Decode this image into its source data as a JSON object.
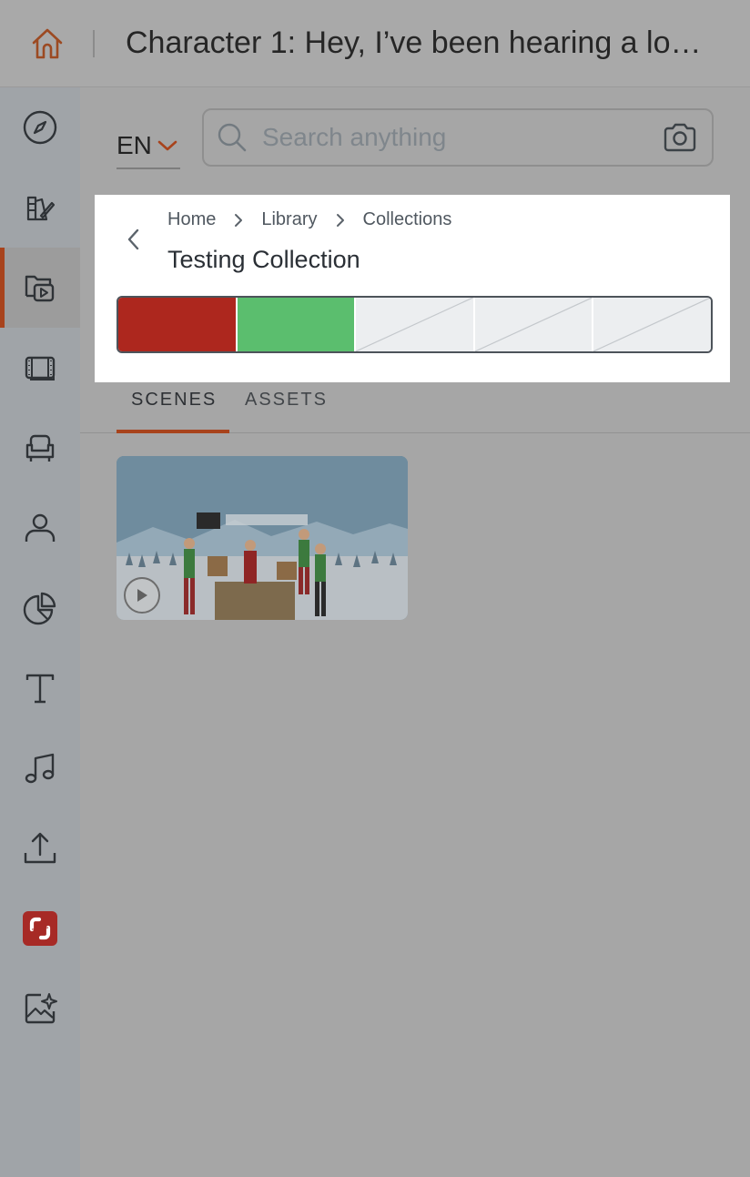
{
  "header": {
    "title": "Character 1: Hey, I’ve been hearing a lo…",
    "home_icon": "home-icon"
  },
  "sidebar": {
    "items": [
      {
        "name": "explore",
        "icon": "compass-icon"
      },
      {
        "name": "design",
        "icon": "palette-brush-icon"
      },
      {
        "name": "library",
        "icon": "folder-play-icon",
        "active": true
      },
      {
        "name": "scenes",
        "icon": "film-icon"
      },
      {
        "name": "props",
        "icon": "armchair-icon"
      },
      {
        "name": "characters",
        "icon": "person-icon"
      },
      {
        "name": "charts",
        "icon": "pie-chart-icon"
      },
      {
        "name": "text",
        "icon": "text-icon"
      },
      {
        "name": "music",
        "icon": "music-note-icon"
      },
      {
        "name": "upload",
        "icon": "upload-icon"
      },
      {
        "name": "brand",
        "icon": "brand-logo-icon"
      },
      {
        "name": "ai-image",
        "icon": "image-sparkle-icon"
      }
    ]
  },
  "language": {
    "value": "EN"
  },
  "search": {
    "placeholder": "Search anything"
  },
  "breadcrumb": {
    "items": [
      "Home",
      "Library",
      "Collections"
    ]
  },
  "collection": {
    "title": "Testing Collection",
    "color_segments": [
      "#ad271e",
      "#5bbe6e",
      null,
      null,
      null
    ]
  },
  "tabs": {
    "scenes": "SCENES",
    "assets": "ASSETS",
    "active": "SCENES"
  },
  "colors": {
    "accent": "#a8431c"
  }
}
